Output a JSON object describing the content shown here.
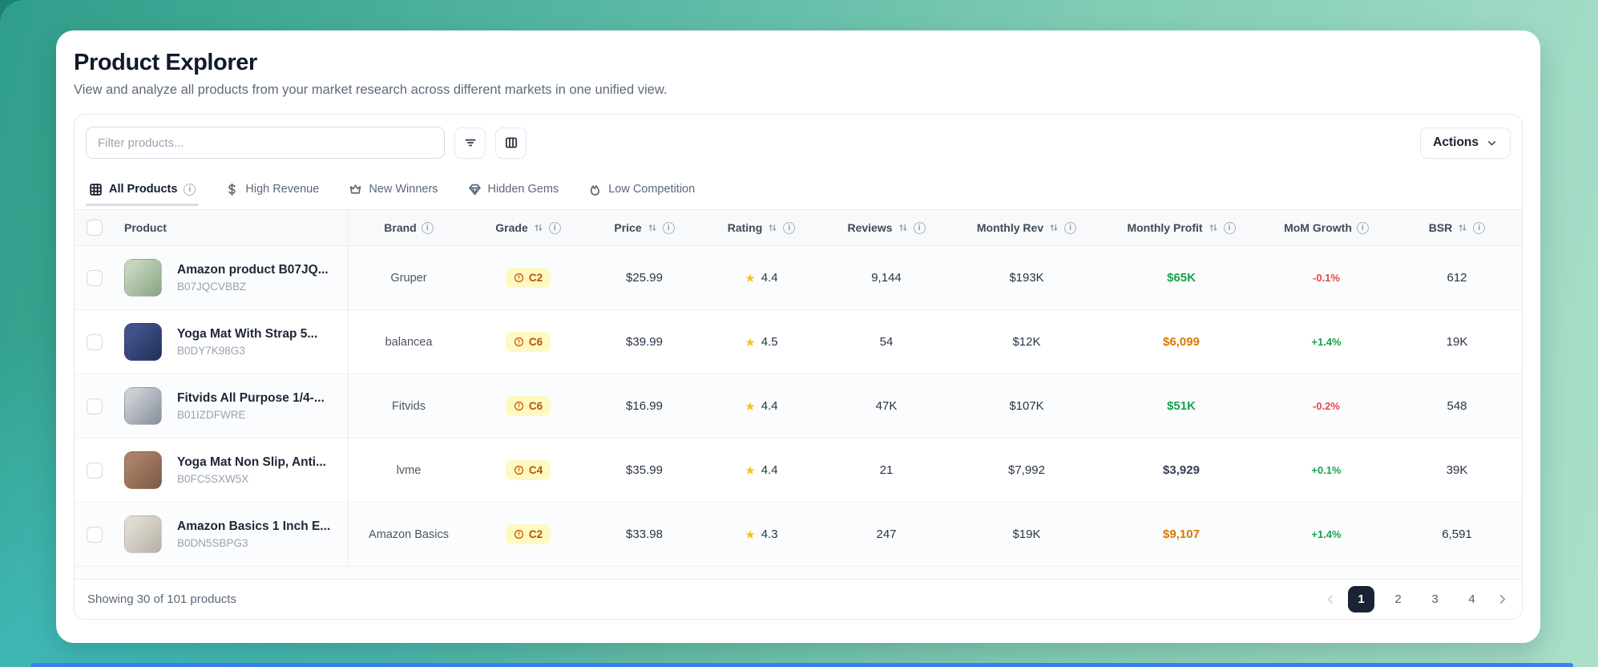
{
  "page": {
    "title": "Product Explorer",
    "subtitle": "View and analyze all products from your market research across different markets in one unified view."
  },
  "toolbar": {
    "filter_placeholder": "Filter products...",
    "filter_button_icon": "filter-lines-icon",
    "columns_button_icon": "columns-icon",
    "actions_label": "Actions",
    "actions_icon": "chevron-down-icon"
  },
  "tabs": [
    {
      "label": "All Products",
      "icon": "grid-icon",
      "active": true,
      "info": true
    },
    {
      "label": "High Revenue",
      "icon": "dollar-icon",
      "active": false,
      "info": false
    },
    {
      "label": "New Winners",
      "icon": "crown-icon",
      "active": false,
      "info": false
    },
    {
      "label": "Hidden Gems",
      "icon": "gem-icon",
      "active": false,
      "info": false
    },
    {
      "label": "Low Competition",
      "icon": "flame-icon",
      "active": false,
      "info": false
    }
  ],
  "table": {
    "columns": [
      {
        "key": "product",
        "label": "Product",
        "sortable": false,
        "info": false
      },
      {
        "key": "brand",
        "label": "Brand",
        "sortable": false,
        "info": true
      },
      {
        "key": "grade",
        "label": "Grade",
        "sortable": true,
        "info": true
      },
      {
        "key": "price",
        "label": "Price",
        "sortable": true,
        "info": true
      },
      {
        "key": "rating",
        "label": "Rating",
        "sortable": true,
        "info": true
      },
      {
        "key": "reviews",
        "label": "Reviews",
        "sortable": true,
        "info": true
      },
      {
        "key": "monthly_rev",
        "label": "Monthly Rev",
        "sortable": true,
        "info": true
      },
      {
        "key": "monthly_profit",
        "label": "Monthly Profit",
        "sortable": true,
        "info": true
      },
      {
        "key": "mom_growth",
        "label": "MoM Growth",
        "sortable": false,
        "info": true
      },
      {
        "key": "bsr",
        "label": "BSR",
        "sortable": true,
        "info": true
      }
    ],
    "rows": [
      {
        "title": "Amazon product B07JQ...",
        "asin": "B07JQCVBBZ",
        "brand": "Gruper",
        "grade": "C2",
        "price": "$25.99",
        "rating": "4.4",
        "reviews": "9,144",
        "monthly_rev": "$193K",
        "monthly_profit": "$65K",
        "profit_color": "green",
        "mom_growth": "-0.1%",
        "mom_color": "red",
        "bsr": "612",
        "image_colors": [
          "#c3d5bc",
          "#87a381"
        ]
      },
      {
        "title": "Yoga Mat With Strap 5...",
        "asin": "B0DY7K98G3",
        "brand": "balancea",
        "grade": "C6",
        "price": "$39.99",
        "rating": "4.5",
        "reviews": "54",
        "monthly_rev": "$12K",
        "monthly_profit": "$6,099",
        "profit_color": "amber",
        "mom_growth": "+1.4%",
        "mom_color": "green",
        "bsr": "19K",
        "image_colors": [
          "#42538c",
          "#222e59"
        ]
      },
      {
        "title": "Fitvids All Purpose 1/4-...",
        "asin": "B01IZDFWRE",
        "brand": "Fitvids",
        "grade": "C6",
        "price": "$16.99",
        "rating": "4.4",
        "reviews": "47K",
        "monthly_rev": "$107K",
        "monthly_profit": "$51K",
        "profit_color": "green",
        "mom_growth": "-0.2%",
        "mom_color": "red",
        "bsr": "548",
        "image_colors": [
          "#c9cdd4",
          "#878e99"
        ]
      },
      {
        "title": "Yoga Mat Non Slip, Anti...",
        "asin": "B0FC5SXW5X",
        "brand": "lvme",
        "grade": "C4",
        "price": "$35.99",
        "rating": "4.4",
        "reviews": "21",
        "monthly_rev": "$7,992",
        "monthly_profit": "$3,929",
        "profit_color": "slate",
        "mom_growth": "+0.1%",
        "mom_color": "green",
        "bsr": "39K",
        "image_colors": [
          "#ab8069",
          "#7c5a45"
        ]
      },
      {
        "title": "Amazon Basics 1 Inch E...",
        "asin": "B0DN5SBPG3",
        "brand": "Amazon Basics",
        "grade": "C2",
        "price": "$33.98",
        "rating": "4.3",
        "reviews": "247",
        "monthly_rev": "$19K",
        "monthly_profit": "$9,107",
        "profit_color": "amber",
        "mom_growth": "+1.4%",
        "mom_color": "green",
        "bsr": "6,591",
        "image_colors": [
          "#e0dbd2",
          "#b6b0a6"
        ]
      }
    ],
    "grade_badge_icon": "alert-circle-icon",
    "rating_icon": "star-icon"
  },
  "footer": {
    "summary": "Showing 30 of 101 products",
    "pagination": {
      "pages": [
        "1",
        "2",
        "3",
        "4"
      ],
      "active_page": "1",
      "prev_icon": "chevron-left-icon",
      "next_icon": "chevron-right-icon"
    }
  },
  "colors": {
    "green": "#16a34a",
    "amber": "#d97706",
    "red": "#ef4444",
    "slate": "#334155",
    "star": "#fbbf24",
    "badge_bg": "#fef9c3",
    "active_page_bg": "#1a2335",
    "accent_blue": "#3b82f6"
  }
}
